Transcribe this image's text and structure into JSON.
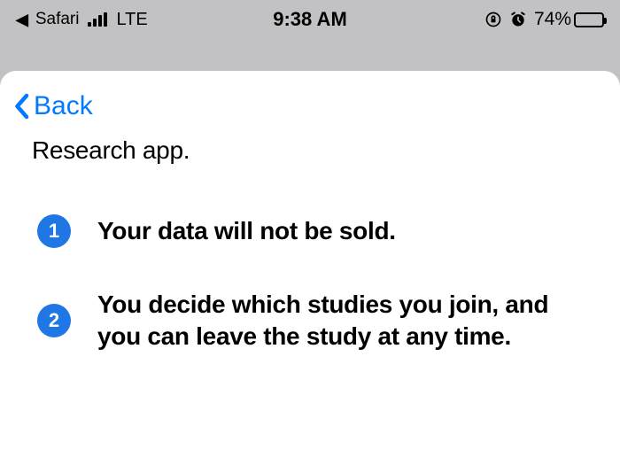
{
  "status": {
    "safari_back_label": "Safari",
    "carrier_label": "LTE",
    "time": "9:38 AM",
    "battery_pct": "74%",
    "battery_fill_pct": 74
  },
  "nav": {
    "back_label": "Back"
  },
  "content": {
    "trail_text": "Research app.",
    "points": [
      {
        "num": "1",
        "text": "Your data will not be sold."
      },
      {
        "num": "2",
        "text": "You decide which studies you join, and you can leave the study at any time."
      }
    ]
  }
}
